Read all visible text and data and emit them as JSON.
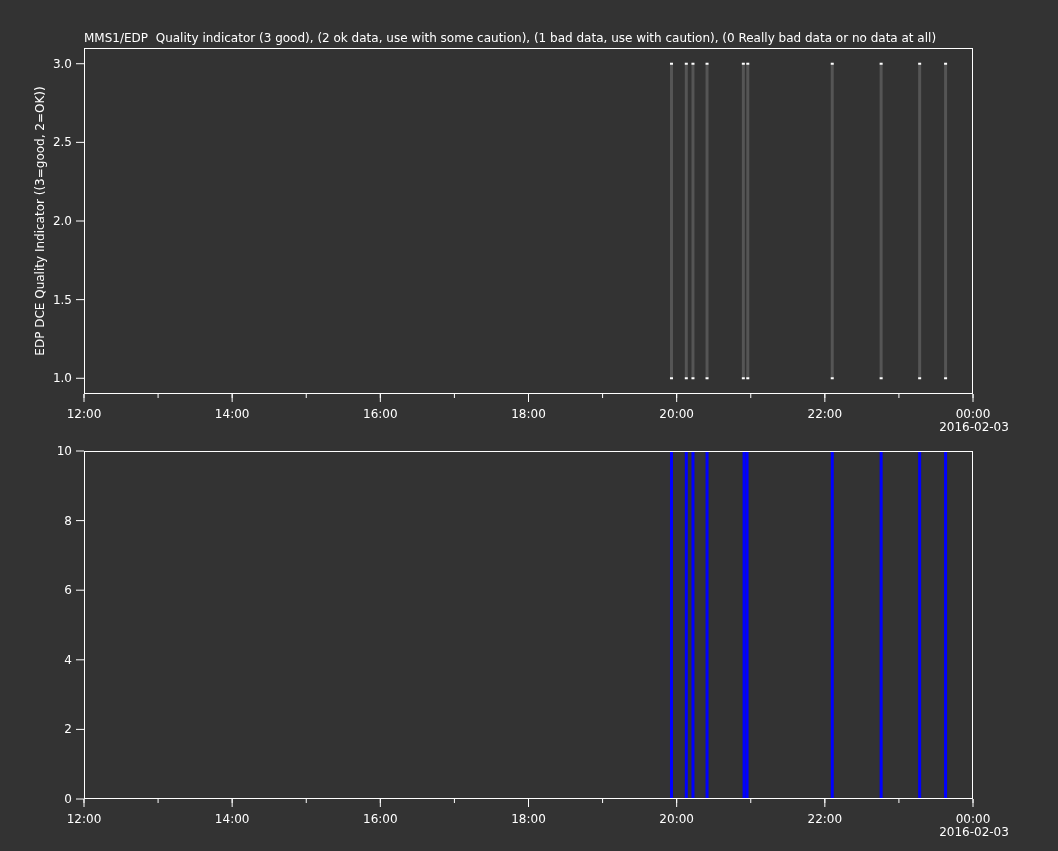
{
  "plot": {
    "title": "MMS1/EDP  Quality indicator (3 good), (2 ok data, use with some caution), (1 bad data, use with caution), (0 Really bad data or no data at all)",
    "panels": [
      {
        "date_label": "2016-02-03",
        "chart_data": {
          "type": "scatter",
          "ylabel": "EDP DCE Quality Indicator ((3=good, 2=OK))",
          "x": [
            19.93,
            20.13,
            20.22,
            20.41,
            20.9,
            20.96,
            22.1,
            22.76,
            23.28,
            23.63
          ],
          "series": [
            {
              "color": "#ffffff",
              "values": [
                3,
                3,
                3,
                3,
                3,
                3,
                3,
                3,
                3,
                3
              ]
            },
            {
              "color": "#ffffff",
              "values": [
                1,
                1,
                1,
                1,
                1,
                1,
                1,
                1,
                1,
                1
              ]
            }
          ],
          "xlim": [
            12,
            24
          ],
          "ylim": [
            0.9,
            3.1
          ],
          "xticks": [
            {
              "value": 12,
              "label": "12:00"
            },
            {
              "value": 14,
              "label": "14:00"
            },
            {
              "value": 16,
              "label": "16:00"
            },
            {
              "value": 18,
              "label": "18:00"
            },
            {
              "value": 20,
              "label": "20:00"
            },
            {
              "value": 22,
              "label": "22:00"
            },
            {
              "value": 24,
              "label": "00:00"
            }
          ],
          "yticks": [
            {
              "value": 1,
              "label": "1.0"
            },
            {
              "value": 1.5,
              "label": "1.5"
            },
            {
              "value": 2,
              "label": "2.0"
            },
            {
              "value": 2.5,
              "label": "2.5"
            },
            {
              "value": 3,
              "label": "3.0"
            }
          ]
        }
      },
      {
        "date_label": "2016-02-03",
        "chart_data": {
          "type": "bar",
          "x": [
            19.93,
            20.13,
            20.22,
            20.41,
            20.91,
            20.95,
            22.1,
            22.76,
            23.28,
            23.63
          ],
          "series": [
            {
              "color": "#0000ff",
              "values": [
                10,
                10,
                10,
                10,
                10,
                10,
                10,
                10,
                10,
                10
              ]
            }
          ],
          "xlim": [
            12,
            24
          ],
          "ylim": [
            0,
            10
          ],
          "xticks": [
            {
              "value": 12,
              "label": "12:00"
            },
            {
              "value": 14,
              "label": "14:00"
            },
            {
              "value": 16,
              "label": "16:00"
            },
            {
              "value": 18,
              "label": "18:00"
            },
            {
              "value": 20,
              "label": "20:00"
            },
            {
              "value": 22,
              "label": "22:00"
            },
            {
              "value": 24,
              "label": "00:00"
            }
          ],
          "yticks": [
            {
              "value": 0,
              "label": "0"
            },
            {
              "value": 2,
              "label": "2"
            },
            {
              "value": 4,
              "label": "4"
            },
            {
              "value": 6,
              "label": "6"
            },
            {
              "value": 8,
              "label": "8"
            },
            {
              "value": 10,
              "label": "10"
            }
          ]
        }
      }
    ]
  }
}
